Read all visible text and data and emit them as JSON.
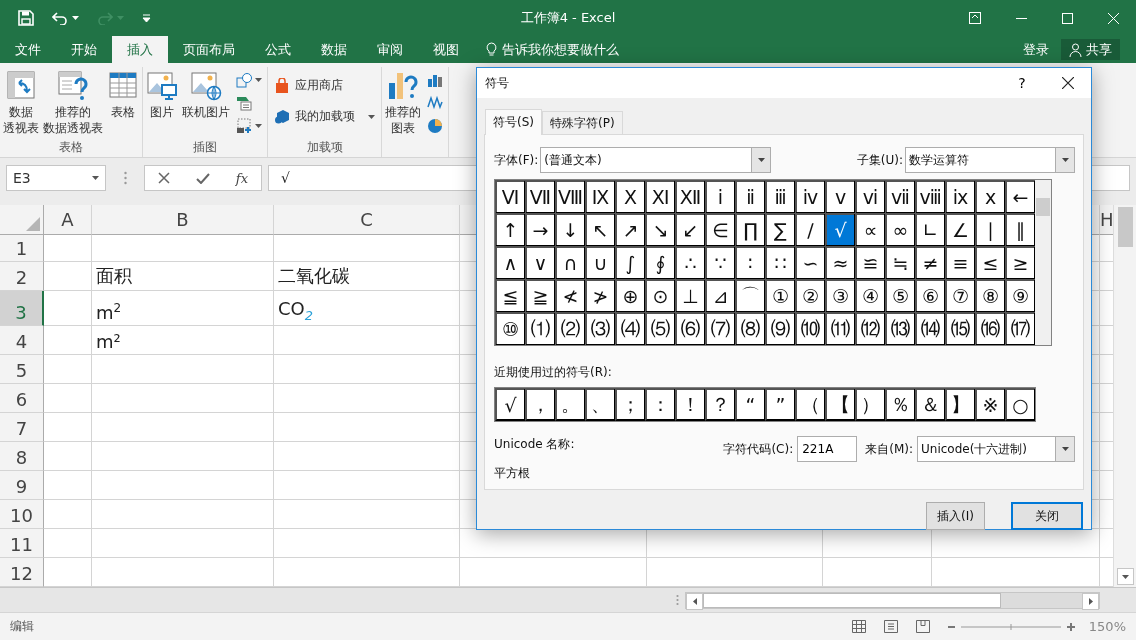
{
  "titlebar": {
    "title": "工作簿4 - Excel"
  },
  "menu_tabs": [
    {
      "label": "文件",
      "selected": false
    },
    {
      "label": "开始",
      "selected": false
    },
    {
      "label": "插入",
      "selected": true
    },
    {
      "label": "页面布局",
      "selected": false
    },
    {
      "label": "公式",
      "selected": false
    },
    {
      "label": "数据",
      "selected": false
    },
    {
      "label": "审阅",
      "selected": false
    },
    {
      "label": "视图",
      "selected": false
    }
  ],
  "tell_me": {
    "placeholder": "告诉我你想要做什么"
  },
  "account": {
    "sign_in": "登录",
    "share": "共享"
  },
  "ribbon": {
    "groups": [
      {
        "label": "表格",
        "items": [
          {
            "kind": "large",
            "lines": [
              "数据",
              "透视表"
            ]
          },
          {
            "kind": "large",
            "lines": [
              "推荐的",
              "数据透视表"
            ]
          },
          {
            "kind": "large",
            "lines": [
              "表格"
            ]
          }
        ]
      },
      {
        "label": "插图",
        "items": [
          {
            "kind": "large",
            "lines": [
              "图片"
            ]
          },
          {
            "kind": "large",
            "lines": [
              "联机图片"
            ]
          },
          {
            "kind": "small",
            "dropdown": true
          },
          {
            "kind": "small",
            "dropdown": false
          },
          {
            "kind": "small",
            "dropdown": true
          }
        ]
      },
      {
        "label": "加载项",
        "items": [
          {
            "kind": "row",
            "label": "应用商店",
            "dropdown": false
          },
          {
            "kind": "row",
            "label": "我的加载项",
            "dropdown": true
          }
        ]
      },
      {
        "items": [
          {
            "kind": "large",
            "lines": [
              "推荐的",
              "图表"
            ]
          },
          {
            "kind": "small",
            "dropdown": false
          },
          {
            "kind": "small",
            "dropdown": false
          },
          {
            "kind": "small",
            "dropdown": false
          }
        ]
      }
    ]
  },
  "formula_bar": {
    "name_box": "E3",
    "fx": "fx",
    "value": "√"
  },
  "sheet": {
    "columns": [
      "A",
      "B",
      "C",
      "H"
    ],
    "rows": [
      {
        "number": "1",
        "selected": false
      },
      {
        "number": "2",
        "selected": false,
        "B": "面积",
        "C": "二氧化碳"
      },
      {
        "number": "3",
        "selected": true,
        "B": "m$^{2}$",
        "C": "CO$_{2}$"
      },
      {
        "number": "4",
        "selected": false,
        "B": "m²"
      },
      {
        "number": "5",
        "selected": false
      },
      {
        "number": "6",
        "selected": false
      },
      {
        "number": "7",
        "selected": false
      },
      {
        "number": "8",
        "selected": false
      },
      {
        "number": "9",
        "selected": false
      },
      {
        "number": "10",
        "selected": false
      },
      {
        "number": "11",
        "selected": false
      },
      {
        "number": "12",
        "selected": false
      }
    ]
  },
  "status_bar": {
    "mode": "编辑",
    "zoom": "150%"
  },
  "dialog": {
    "title": "符号",
    "help": "?",
    "tabs": [
      {
        "label": "符号(S)",
        "selected": true
      },
      {
        "label": "特殊字符(P)",
        "selected": false
      }
    ],
    "font_label": "字体(F):",
    "font_value": "(普通文本)",
    "subset_label": "子集(U):",
    "subset_value": "数学运算符",
    "symbols": [
      [
        {
          "char": "Ⅵ",
          "selected": false
        },
        {
          "char": "Ⅶ",
          "selected": false
        },
        {
          "char": "Ⅷ",
          "selected": false
        },
        {
          "char": "Ⅸ",
          "selected": false
        },
        {
          "char": "Ⅹ",
          "selected": false
        },
        {
          "char": "Ⅺ",
          "selected": false
        },
        {
          "char": "Ⅻ",
          "selected": false
        },
        {
          "char": "ⅰ",
          "selected": false
        },
        {
          "char": "ⅱ",
          "selected": false
        },
        {
          "char": "ⅲ",
          "selected": false
        },
        {
          "char": "ⅳ",
          "selected": false
        },
        {
          "char": "ⅴ",
          "selected": false
        },
        {
          "char": "ⅵ",
          "selected": false
        },
        {
          "char": "ⅶ",
          "selected": false
        },
        {
          "char": "ⅷ",
          "selected": false
        },
        {
          "char": "ⅸ",
          "selected": false
        },
        {
          "char": "ⅹ",
          "selected": false
        },
        {
          "char": "←",
          "selected": false
        }
      ],
      [
        {
          "char": "↑",
          "selected": false
        },
        {
          "char": "→",
          "selected": false
        },
        {
          "char": "↓",
          "selected": false
        },
        {
          "char": "↖",
          "selected": false
        },
        {
          "char": "↗",
          "selected": false
        },
        {
          "char": "↘",
          "selected": false
        },
        {
          "char": "↙",
          "selected": false
        },
        {
          "char": "∈",
          "selected": false
        },
        {
          "char": "∏",
          "selected": false
        },
        {
          "char": "∑",
          "selected": false
        },
        {
          "char": "∕",
          "selected": false
        },
        {
          "char": "√",
          "selected": true
        },
        {
          "char": "∝",
          "selected": false
        },
        {
          "char": "∞",
          "selected": false
        },
        {
          "char": "∟",
          "selected": false
        },
        {
          "char": "∠",
          "selected": false
        },
        {
          "char": "∣",
          "selected": false
        },
        {
          "char": "∥",
          "selected": false
        }
      ],
      [
        {
          "char": "∧",
          "selected": false
        },
        {
          "char": "∨",
          "selected": false
        },
        {
          "char": "∩",
          "selected": false
        },
        {
          "char": "∪",
          "selected": false
        },
        {
          "char": "∫",
          "selected": false
        },
        {
          "char": "∮",
          "selected": false
        },
        {
          "char": "∴",
          "selected": false
        },
        {
          "char": "∵",
          "selected": false
        },
        {
          "char": "∶",
          "selected": false
        },
        {
          "char": "∷",
          "selected": false
        },
        {
          "char": "∽",
          "selected": false
        },
        {
          "char": "≈",
          "selected": false
        },
        {
          "char": "≌",
          "selected": false
        },
        {
          "char": "≒",
          "selected": false
        },
        {
          "char": "≠",
          "selected": false
        },
        {
          "char": "≡",
          "selected": false
        },
        {
          "char": "≤",
          "selected": false
        },
        {
          "char": "≥",
          "selected": false
        }
      ],
      [
        {
          "char": "≦",
          "selected": false
        },
        {
          "char": "≧",
          "selected": false
        },
        {
          "char": "≮",
          "selected": false
        },
        {
          "char": "≯",
          "selected": false
        },
        {
          "char": "⊕",
          "selected": false
        },
        {
          "char": "⊙",
          "selected": false
        },
        {
          "char": "⊥",
          "selected": false
        },
        {
          "char": "⊿",
          "selected": false
        },
        {
          "char": "⌒",
          "selected": false
        },
        {
          "char": "①",
          "selected": false
        },
        {
          "char": "②",
          "selected": false
        },
        {
          "char": "③",
          "selected": false
        },
        {
          "char": "④",
          "selected": false
        },
        {
          "char": "⑤",
          "selected": false
        },
        {
          "char": "⑥",
          "selected": false
        },
        {
          "char": "⑦",
          "selected": false
        },
        {
          "char": "⑧",
          "selected": false
        },
        {
          "char": "⑨",
          "selected": false
        }
      ],
      [
        {
          "char": "⑩",
          "selected": false
        },
        {
          "char": "⑴",
          "selected": false
        },
        {
          "char": "⑵",
          "selected": false
        },
        {
          "char": "⑶",
          "selected": false
        },
        {
          "char": "⑷",
          "selected": false
        },
        {
          "char": "⑸",
          "selected": false
        },
        {
          "char": "⑹",
          "selected": false
        },
        {
          "char": "⑺",
          "selected": false
        },
        {
          "char": "⑻",
          "selected": false
        },
        {
          "char": "⑼",
          "selected": false
        },
        {
          "char": "⑽",
          "selected": false
        },
        {
          "char": "⑾",
          "selected": false
        },
        {
          "char": "⑿",
          "selected": false
        },
        {
          "char": "⒀",
          "selected": false
        },
        {
          "char": "⒁",
          "selected": false
        },
        {
          "char": "⒂",
          "selected": false
        },
        {
          "char": "⒃",
          "selected": false
        },
        {
          "char": "⒄",
          "selected": false
        }
      ]
    ],
    "recent_label": "近期使用过的符号(R):",
    "recent": [
      {
        "char": "√",
        "selected": false
      },
      {
        "char": "，",
        "selected": false
      },
      {
        "char": "。",
        "selected": false
      },
      {
        "char": "、",
        "selected": false
      },
      {
        "char": "；",
        "selected": false
      },
      {
        "char": "：",
        "selected": false
      },
      {
        "char": "！",
        "selected": false
      },
      {
        "char": "？",
        "selected": false
      },
      {
        "char": "“",
        "selected": false
      },
      {
        "char": "”",
        "selected": false
      },
      {
        "char": "（",
        "selected": false
      },
      {
        "char": "【",
        "selected": false
      },
      {
        "char": "）",
        "selected": false
      },
      {
        "char": "％",
        "selected": false
      },
      {
        "char": "＆",
        "selected": false
      },
      {
        "char": "】",
        "selected": false
      },
      {
        "char": "※",
        "selected": false
      },
      {
        "char": "○",
        "selected": false
      }
    ],
    "unicode_name_label": "Unicode 名称:",
    "unicode_name": "平方根",
    "code_label": "字符代码(C):",
    "code_value": "221A",
    "from_label": "来自(M):",
    "from_value": "Unicode(十六进制)",
    "buttons": [
      {
        "label": "插入(I)",
        "default": false
      },
      {
        "label": "关闭",
        "default": true
      }
    ]
  }
}
